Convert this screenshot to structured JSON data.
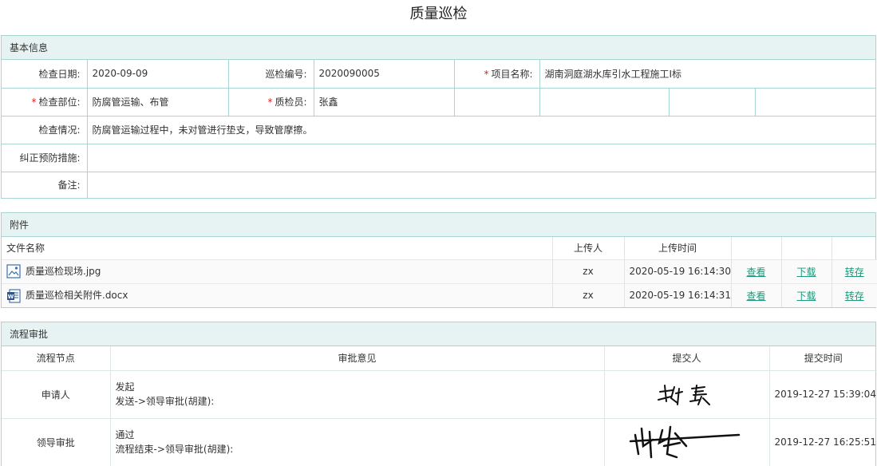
{
  "title": "质量巡检",
  "basic": {
    "header": "基本信息",
    "check_date_label": "检查日期:",
    "check_date": "2020-09-09",
    "patrol_no_label": "巡检编号:",
    "patrol_no": "2020090005",
    "project_label": "项目名称:",
    "project": "湖南洞庭湖水库引水工程施工I标",
    "part_label": "检查部位:",
    "part": "防腐管运输、布管",
    "inspector_label": "质检员:",
    "inspector": "张鑫",
    "situation_label": "检查情况:",
    "situation": "防腐管运输过程中，未对管进行垫支，导致管摩擦。",
    "measure_label": "纠正预防措施:",
    "measure": "",
    "remark_label": "备注:",
    "remark": "",
    "required_mark": "*"
  },
  "attachments": {
    "header": "附件",
    "columns": {
      "name": "文件名称",
      "uploader": "上传人",
      "time": "上传时间"
    },
    "actions": {
      "view": "查看",
      "download": "下载",
      "transfer": "转存"
    },
    "files": [
      {
        "icon": "image-file-icon",
        "name": "质量巡检现场.jpg",
        "uploader": "zx",
        "time": "2020-05-19 16:14:30"
      },
      {
        "icon": "word-file-icon",
        "name": "质量巡检相关附件.docx",
        "uploader": "zx",
        "time": "2020-05-19 16:14:31"
      }
    ]
  },
  "flow": {
    "header": "流程审批",
    "columns": {
      "node": "流程节点",
      "opinion": "审批意见",
      "submitter": "提交人",
      "time": "提交时间"
    },
    "rows": [
      {
        "node": "申请人",
        "opinion_line1": "发起",
        "opinion_line2": "发送->领导审批(胡建):",
        "time": "2019-12-27 15:39:04"
      },
      {
        "node": "领导审批",
        "opinion_line1": "通过",
        "opinion_line2": "流程结束->领导审批(胡建):",
        "time": "2019-12-27 16:25:51"
      }
    ]
  },
  "colors": {
    "border": "#a9d5d0",
    "header_bg": "#e6f3f2",
    "link": "#1a9a7a",
    "required": "#e02020"
  }
}
